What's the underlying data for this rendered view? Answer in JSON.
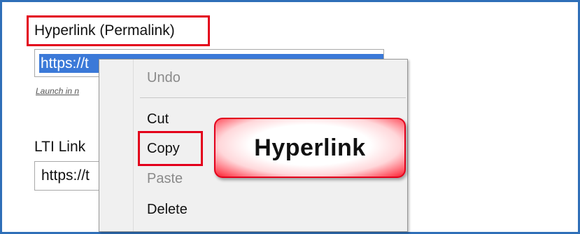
{
  "hyperlink": {
    "label": "Hyperlink (Permalink)",
    "url_value": "https://t",
    "launch_text": "Launch in n"
  },
  "lti": {
    "label": "LTI Link",
    "url_value": "https://t"
  },
  "context_menu": {
    "items": [
      {
        "label": "Undo",
        "enabled": false
      },
      {
        "label": "Cut",
        "enabled": true
      },
      {
        "label": "Copy",
        "enabled": true
      },
      {
        "label": "Paste",
        "enabled": false
      },
      {
        "label": "Delete",
        "enabled": true
      }
    ]
  },
  "callout": {
    "text": "Hyperlink"
  },
  "colors": {
    "frame": "#2f6fb8",
    "highlight": "#e3001b",
    "selection": "#3b79d8"
  }
}
